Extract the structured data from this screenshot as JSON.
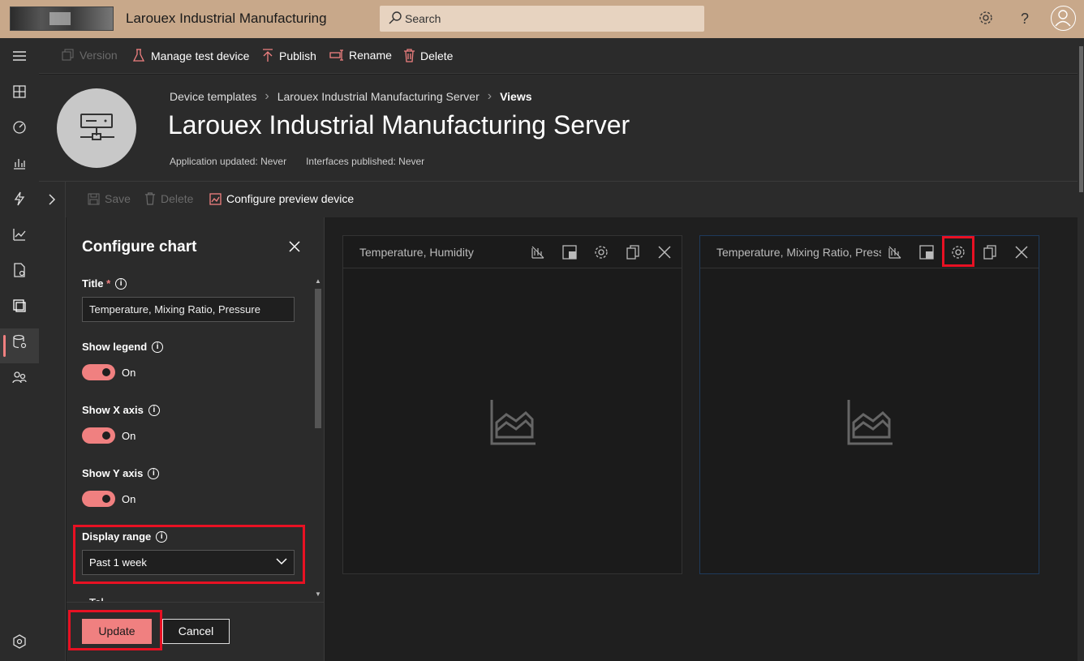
{
  "app": {
    "title": "Larouex Industrial Manufacturing"
  },
  "search": {
    "placeholder": "Search"
  },
  "commands": {
    "version": "Version",
    "manage_test_device": "Manage test device",
    "publish": "Publish",
    "rename": "Rename",
    "delete": "Delete"
  },
  "breadcrumb": {
    "root": "Device templates",
    "template": "Larouex Industrial Manufacturing Server",
    "current": "Views"
  },
  "page": {
    "title": "Larouex Industrial Manufacturing Server",
    "app_updated": "Application updated: Never",
    "interfaces_published": "Interfaces published: Never"
  },
  "subcommands": {
    "save": "Save",
    "delete": "Delete",
    "configure_preview": "Configure preview device"
  },
  "panel": {
    "title": "Configure chart",
    "title_label": "Title",
    "required_mark": "*",
    "title_value": "Temperature, Mixing Ratio, Pressure",
    "show_legend": "Show legend",
    "show_x_axis": "Show X axis",
    "show_y_axis": "Show Y axis",
    "on_label": "On",
    "display_range_label": "Display range",
    "display_range_value": "Past 1 week",
    "next_section": "Tel",
    "update": "Update",
    "cancel": "Cancel"
  },
  "tiles": [
    {
      "title": "Temperature, Humidity"
    },
    {
      "title": "Temperature, Mixing Ratio, Pressure"
    }
  ],
  "colors": {
    "accent": "#f08080",
    "topbar": "#c8a88a",
    "highlight": "#e81123"
  }
}
